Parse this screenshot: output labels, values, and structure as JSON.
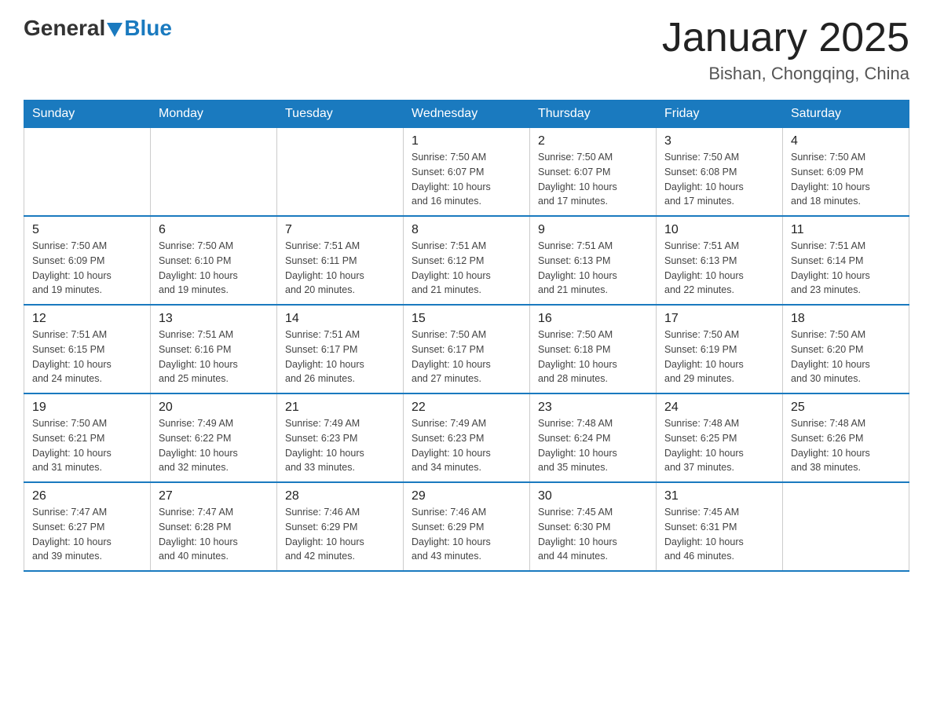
{
  "logo": {
    "general": "General",
    "blue": "Blue"
  },
  "title": "January 2025",
  "subtitle": "Bishan, Chongqing, China",
  "headers": [
    "Sunday",
    "Monday",
    "Tuesday",
    "Wednesday",
    "Thursday",
    "Friday",
    "Saturday"
  ],
  "weeks": [
    [
      {
        "day": "",
        "info": ""
      },
      {
        "day": "",
        "info": ""
      },
      {
        "day": "",
        "info": ""
      },
      {
        "day": "1",
        "info": "Sunrise: 7:50 AM\nSunset: 6:07 PM\nDaylight: 10 hours\nand 16 minutes."
      },
      {
        "day": "2",
        "info": "Sunrise: 7:50 AM\nSunset: 6:07 PM\nDaylight: 10 hours\nand 17 minutes."
      },
      {
        "day": "3",
        "info": "Sunrise: 7:50 AM\nSunset: 6:08 PM\nDaylight: 10 hours\nand 17 minutes."
      },
      {
        "day": "4",
        "info": "Sunrise: 7:50 AM\nSunset: 6:09 PM\nDaylight: 10 hours\nand 18 minutes."
      }
    ],
    [
      {
        "day": "5",
        "info": "Sunrise: 7:50 AM\nSunset: 6:09 PM\nDaylight: 10 hours\nand 19 minutes."
      },
      {
        "day": "6",
        "info": "Sunrise: 7:50 AM\nSunset: 6:10 PM\nDaylight: 10 hours\nand 19 minutes."
      },
      {
        "day": "7",
        "info": "Sunrise: 7:51 AM\nSunset: 6:11 PM\nDaylight: 10 hours\nand 20 minutes."
      },
      {
        "day": "8",
        "info": "Sunrise: 7:51 AM\nSunset: 6:12 PM\nDaylight: 10 hours\nand 21 minutes."
      },
      {
        "day": "9",
        "info": "Sunrise: 7:51 AM\nSunset: 6:13 PM\nDaylight: 10 hours\nand 21 minutes."
      },
      {
        "day": "10",
        "info": "Sunrise: 7:51 AM\nSunset: 6:13 PM\nDaylight: 10 hours\nand 22 minutes."
      },
      {
        "day": "11",
        "info": "Sunrise: 7:51 AM\nSunset: 6:14 PM\nDaylight: 10 hours\nand 23 minutes."
      }
    ],
    [
      {
        "day": "12",
        "info": "Sunrise: 7:51 AM\nSunset: 6:15 PM\nDaylight: 10 hours\nand 24 minutes."
      },
      {
        "day": "13",
        "info": "Sunrise: 7:51 AM\nSunset: 6:16 PM\nDaylight: 10 hours\nand 25 minutes."
      },
      {
        "day": "14",
        "info": "Sunrise: 7:51 AM\nSunset: 6:17 PM\nDaylight: 10 hours\nand 26 minutes."
      },
      {
        "day": "15",
        "info": "Sunrise: 7:50 AM\nSunset: 6:17 PM\nDaylight: 10 hours\nand 27 minutes."
      },
      {
        "day": "16",
        "info": "Sunrise: 7:50 AM\nSunset: 6:18 PM\nDaylight: 10 hours\nand 28 minutes."
      },
      {
        "day": "17",
        "info": "Sunrise: 7:50 AM\nSunset: 6:19 PM\nDaylight: 10 hours\nand 29 minutes."
      },
      {
        "day": "18",
        "info": "Sunrise: 7:50 AM\nSunset: 6:20 PM\nDaylight: 10 hours\nand 30 minutes."
      }
    ],
    [
      {
        "day": "19",
        "info": "Sunrise: 7:50 AM\nSunset: 6:21 PM\nDaylight: 10 hours\nand 31 minutes."
      },
      {
        "day": "20",
        "info": "Sunrise: 7:49 AM\nSunset: 6:22 PM\nDaylight: 10 hours\nand 32 minutes."
      },
      {
        "day": "21",
        "info": "Sunrise: 7:49 AM\nSunset: 6:23 PM\nDaylight: 10 hours\nand 33 minutes."
      },
      {
        "day": "22",
        "info": "Sunrise: 7:49 AM\nSunset: 6:23 PM\nDaylight: 10 hours\nand 34 minutes."
      },
      {
        "day": "23",
        "info": "Sunrise: 7:48 AM\nSunset: 6:24 PM\nDaylight: 10 hours\nand 35 minutes."
      },
      {
        "day": "24",
        "info": "Sunrise: 7:48 AM\nSunset: 6:25 PM\nDaylight: 10 hours\nand 37 minutes."
      },
      {
        "day": "25",
        "info": "Sunrise: 7:48 AM\nSunset: 6:26 PM\nDaylight: 10 hours\nand 38 minutes."
      }
    ],
    [
      {
        "day": "26",
        "info": "Sunrise: 7:47 AM\nSunset: 6:27 PM\nDaylight: 10 hours\nand 39 minutes."
      },
      {
        "day": "27",
        "info": "Sunrise: 7:47 AM\nSunset: 6:28 PM\nDaylight: 10 hours\nand 40 minutes."
      },
      {
        "day": "28",
        "info": "Sunrise: 7:46 AM\nSunset: 6:29 PM\nDaylight: 10 hours\nand 42 minutes."
      },
      {
        "day": "29",
        "info": "Sunrise: 7:46 AM\nSunset: 6:29 PM\nDaylight: 10 hours\nand 43 minutes."
      },
      {
        "day": "30",
        "info": "Sunrise: 7:45 AM\nSunset: 6:30 PM\nDaylight: 10 hours\nand 44 minutes."
      },
      {
        "day": "31",
        "info": "Sunrise: 7:45 AM\nSunset: 6:31 PM\nDaylight: 10 hours\nand 46 minutes."
      },
      {
        "day": "",
        "info": ""
      }
    ]
  ]
}
